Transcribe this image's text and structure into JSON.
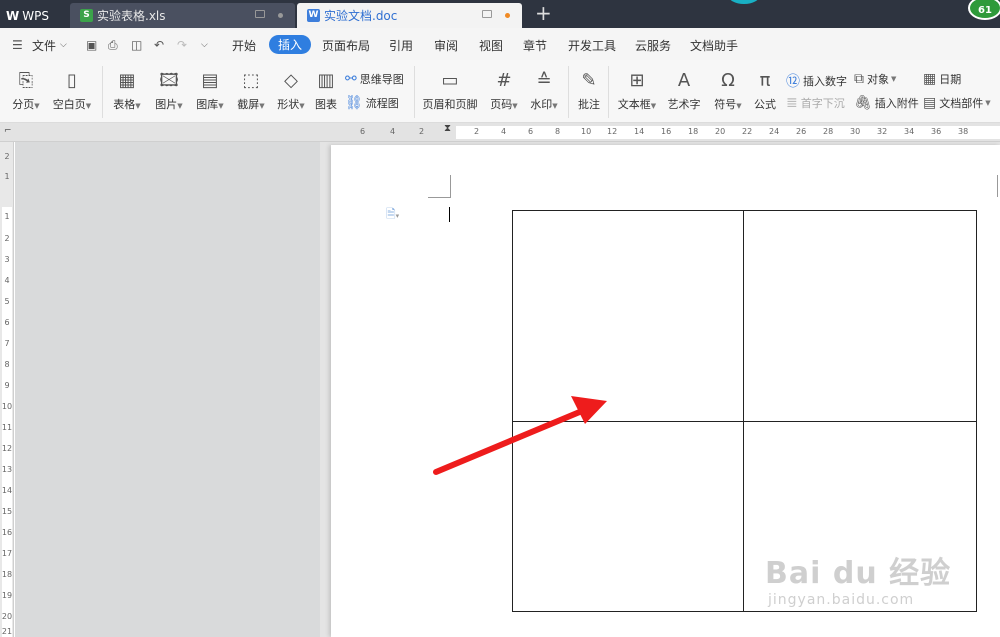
{
  "tabs": {
    "wps": "WPS",
    "xls": "实验表格.xls",
    "doc": "实验文档.doc",
    "badge": "61"
  },
  "menu": {
    "file": "文件",
    "items": [
      "开始",
      "插入",
      "页面布局",
      "引用",
      "审阅",
      "视图",
      "章节",
      "开发工具",
      "云服务",
      "文档助手"
    ],
    "active": "插入"
  },
  "ribbon": {
    "page_break": "分页",
    "blank_page": "空白页",
    "table": "表格",
    "picture": "图片",
    "gallery": "图库",
    "screenshot": "截屏",
    "shape": "形状",
    "chart": "图表",
    "mindmap": "思维导图",
    "flowchart": "流程图",
    "header_footer": "页眉和页脚",
    "page_number": "页码",
    "watermark": "水印",
    "comment": "批注",
    "textbox": "文本框",
    "wordart": "艺术字",
    "symbol": "符号",
    "equation": "公式",
    "insert_number": "插入数字",
    "drop_cap": "首字下沉",
    "object": "对象",
    "attachment": "插入附件",
    "date": "日期",
    "doc_parts": "文档部件"
  },
  "ruler": {
    "h": [
      "6",
      "4",
      "2",
      "2",
      "4",
      "6",
      "8",
      "10",
      "12",
      "14",
      "16",
      "18",
      "20",
      "22",
      "24",
      "26",
      "28",
      "30",
      "32",
      "34",
      "36",
      "38"
    ],
    "v": [
      "2",
      "1",
      "1",
      "2",
      "3",
      "4",
      "5",
      "6",
      "7",
      "8",
      "9",
      "10",
      "11",
      "12",
      "13",
      "14",
      "15",
      "16",
      "17",
      "18",
      "19",
      "20",
      "21"
    ]
  },
  "watermark": {
    "brand": "Bai du 经验",
    "url": "jingyan.baidu.com"
  },
  "colors": {
    "accent": "#2f7ee0",
    "arrow": "#ee1c1c",
    "titlebar": "#2e3440"
  }
}
